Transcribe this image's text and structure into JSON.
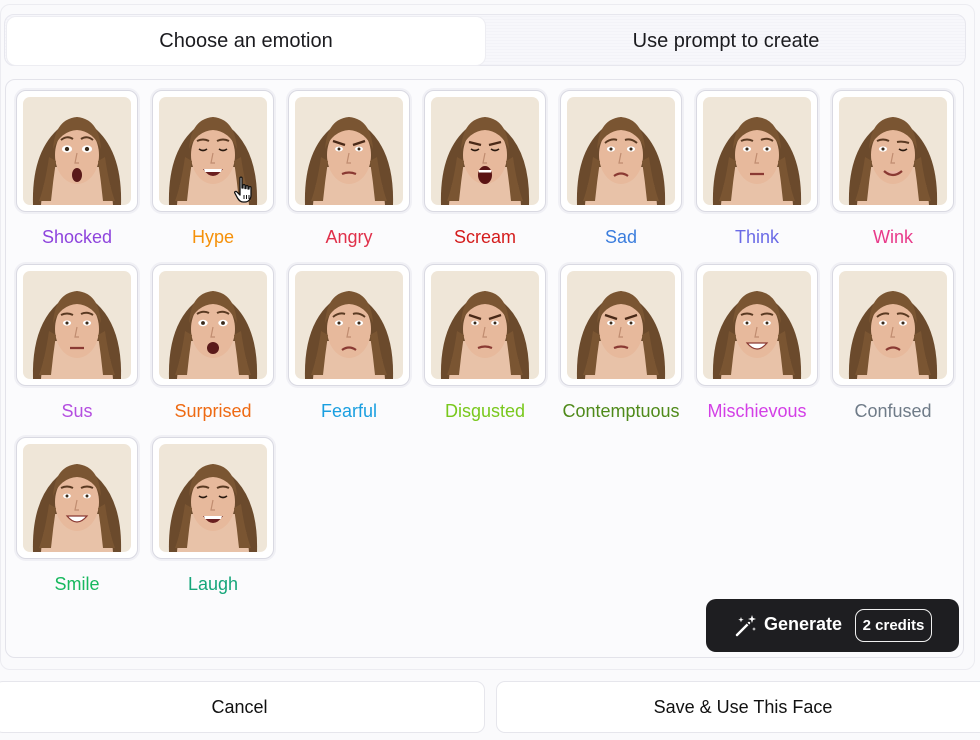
{
  "tabs": [
    {
      "label": "Choose an emotion",
      "active": true
    },
    {
      "label": "Use prompt to create",
      "active": false
    }
  ],
  "emotions": [
    {
      "label": "Shocked",
      "color": "#8e44dd",
      "expr": "shocked"
    },
    {
      "label": "Hype",
      "color": "#f5910a",
      "expr": "hype"
    },
    {
      "label": "Angry",
      "color": "#e0304a",
      "expr": "angry"
    },
    {
      "label": "Scream",
      "color": "#d41c1c",
      "expr": "scream"
    },
    {
      "label": "Sad",
      "color": "#3b7ddd",
      "expr": "sad"
    },
    {
      "label": "Think",
      "color": "#6b6be6",
      "expr": "think"
    },
    {
      "label": "Wink",
      "color": "#e83a8a",
      "expr": "wink"
    },
    {
      "label": "Sus",
      "color": "#b44ee0",
      "expr": "sus"
    },
    {
      "label": "Surprised",
      "color": "#ee6a13",
      "expr": "surprised"
    },
    {
      "label": "Fearful",
      "color": "#1a9fe0",
      "expr": "fearful"
    },
    {
      "label": "Disgusted",
      "color": "#79c81d",
      "expr": "disgusted"
    },
    {
      "label": "Contemptuous",
      "color": "#4f8a1a",
      "expr": "contempt"
    },
    {
      "label": "Mischievous",
      "color": "#d33fe6",
      "expr": "mischievous"
    },
    {
      "label": "Confused",
      "color": "#6f7b88",
      "expr": "confused"
    },
    {
      "label": "Smile",
      "color": "#17b85e",
      "expr": "smile"
    },
    {
      "label": "Laugh",
      "color": "#16a67a",
      "expr": "laugh"
    }
  ],
  "generate": {
    "label": "Generate",
    "credits": "2 credits",
    "icon": "magic-wand-icon"
  },
  "footer": {
    "cancel_label": "Cancel",
    "save_label": "Save & Use This Face"
  }
}
